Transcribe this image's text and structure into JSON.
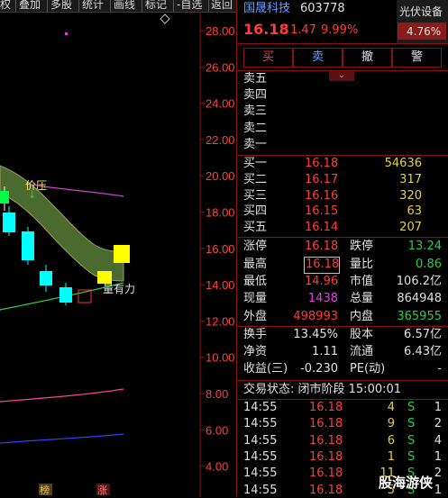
{
  "toolbar": {
    "items": [
      "权",
      "叠加",
      "多股",
      "统计",
      "画线",
      "标记",
      "-自选",
      "返回"
    ]
  },
  "chart": {
    "y_ticks": [
      "28.00",
      "26.00",
      "24.00",
      "22.00",
      "20.00",
      "18.00",
      "16.00",
      "14.00",
      "12.00",
      "10.00",
      "8.00",
      "6.00",
      "4.00"
    ],
    "annotation_resistance": "价压",
    "annotation_support": "量有力",
    "bottom_tags": [
      "榜",
      "涨"
    ],
    "diamond_icon": "◇",
    "colors": {
      "up": "#ff3030",
      "down": "#00ffff",
      "band": "#4a6a30",
      "accent_yellow": "#ffff00"
    }
  },
  "header": {
    "name": "国晟科技",
    "code": "603778",
    "price": "16.18",
    "change": "1.47",
    "change_pct": "9.99%",
    "sector": "光伏设备",
    "sector_pct": "4.76%"
  },
  "trade_buttons": [
    "买",
    "卖",
    "撤",
    "警"
  ],
  "expand_icon": "chevron-double-down",
  "ask": [
    {
      "label": "卖五",
      "price": "",
      "vol": ""
    },
    {
      "label": "卖四",
      "price": "",
      "vol": ""
    },
    {
      "label": "卖三",
      "price": "",
      "vol": ""
    },
    {
      "label": "卖二",
      "price": "",
      "vol": ""
    },
    {
      "label": "卖一",
      "price": "",
      "vol": ""
    }
  ],
  "bid": [
    {
      "label": "买一",
      "price": "16.18",
      "vol": "54636"
    },
    {
      "label": "买二",
      "price": "16.17",
      "vol": "317"
    },
    {
      "label": "买三",
      "price": "16.16",
      "vol": "320"
    },
    {
      "label": "买四",
      "price": "16.15",
      "vol": "63"
    },
    {
      "label": "买五",
      "price": "16.14",
      "vol": "207"
    }
  ],
  "stats": {
    "limit_up_label": "涨停",
    "limit_up": "16.18",
    "limit_down_label": "跌停",
    "limit_down": "13.24",
    "high_label": "最高",
    "high": "16.18",
    "vol_ratio_label": "量比",
    "vol_ratio": "0.86",
    "low_label": "最低",
    "low": "14.96",
    "mkt_cap_label": "市值",
    "mkt_cap": "106.2亿",
    "cur_vol_label": "现量",
    "cur_vol": "1438",
    "total_vol_label": "总量",
    "total_vol": "864948",
    "outer_label": "外盘",
    "outer": "498993",
    "inner_label": "内盘",
    "inner": "365955"
  },
  "fundamentals": {
    "turnover_label": "换手",
    "turnover": "13.45%",
    "equity_label": "股本",
    "equity": "6.57亿",
    "nav_label": "净资",
    "nav": "1.11",
    "float_label": "流通",
    "float": "6.43亿",
    "eps_label": "收益(三)",
    "eps": "-0.230",
    "pe_label": "PE(动)",
    "pe": "-"
  },
  "status": "交易状态: 闭市阶段 15:00:01",
  "ticks": [
    {
      "time": "14:55",
      "price": "16.18",
      "vol": "4",
      "side": "S",
      "n": "1"
    },
    {
      "time": "14:55",
      "price": "16.18",
      "vol": "9",
      "side": "S",
      "n": "2"
    },
    {
      "time": "14:55",
      "price": "16.18",
      "vol": "6",
      "side": "S",
      "n": "4"
    },
    {
      "time": "14:55",
      "price": "16.18",
      "vol": "1",
      "side": "S",
      "n": "1"
    },
    {
      "time": "14:55",
      "price": "16.18",
      "vol": "11",
      "side": "S",
      "n": "2"
    },
    {
      "time": "14:55",
      "price": "16.18",
      "vol": "5",
      "side": "S",
      "n": "1"
    }
  ],
  "watermark": "股海游侠"
}
